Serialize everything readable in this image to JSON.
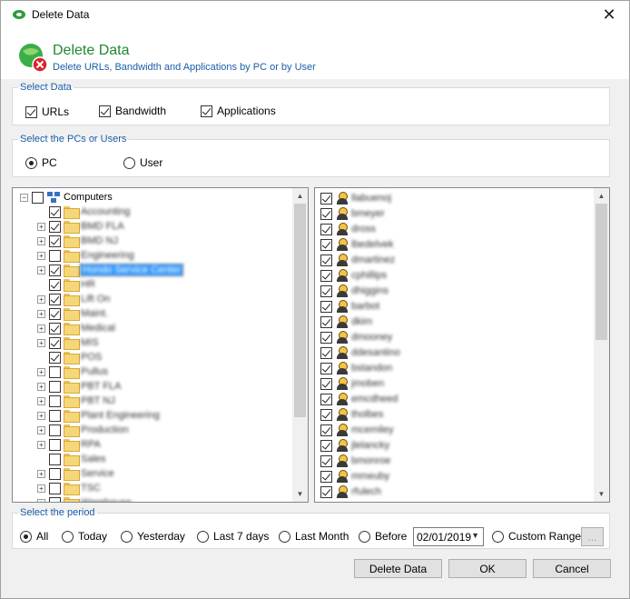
{
  "window": {
    "title": "Delete Data",
    "close_glyph": "✕"
  },
  "header": {
    "title": "Delete Data",
    "subtitle": "Delete URLs, Bandwidth and Applications by PC or by User"
  },
  "select_data": {
    "legend": "Select Data",
    "options": [
      {
        "label": "URLs",
        "checked": true
      },
      {
        "label": "Bandwidth",
        "checked": true
      },
      {
        "label": "Applications",
        "checked": true
      }
    ]
  },
  "select_pcs": {
    "legend": "Select the PCs or Users",
    "options": [
      {
        "label": "PC",
        "selected": true
      },
      {
        "label": "User",
        "selected": false
      }
    ]
  },
  "tree": {
    "root_label": "Computers",
    "items": [
      {
        "label": "Accounting",
        "checked": true,
        "expander": false
      },
      {
        "label": "BMD FLA",
        "checked": true,
        "expander": true
      },
      {
        "label": "BMD NJ",
        "checked": true,
        "expander": true
      },
      {
        "label": "Engineering",
        "checked": false,
        "expander": true
      },
      {
        "label": "Hondo Service Center",
        "checked": true,
        "expander": true,
        "selected": true
      },
      {
        "label": "HR",
        "checked": true,
        "expander": false
      },
      {
        "label": "Lift On",
        "checked": true,
        "expander": true
      },
      {
        "label": "Maint.",
        "checked": true,
        "expander": true
      },
      {
        "label": "Medical",
        "checked": true,
        "expander": true
      },
      {
        "label": "MIS",
        "checked": true,
        "expander": true
      },
      {
        "label": "POS",
        "checked": true,
        "expander": false
      },
      {
        "label": "Pullus",
        "checked": false,
        "expander": true
      },
      {
        "label": "PBT FLA",
        "checked": false,
        "expander": true
      },
      {
        "label": "PBT NJ",
        "checked": false,
        "expander": true
      },
      {
        "label": "Plant Engineering",
        "checked": false,
        "expander": true
      },
      {
        "label": "Production",
        "checked": false,
        "expander": true
      },
      {
        "label": "RPA",
        "checked": false,
        "expander": true
      },
      {
        "label": "Sales",
        "checked": false,
        "expander": false
      },
      {
        "label": "Service",
        "checked": false,
        "expander": true
      },
      {
        "label": "TSC",
        "checked": false,
        "expander": true
      },
      {
        "label": "Warehouse",
        "checked": false,
        "expander": true
      }
    ]
  },
  "users": [
    {
      "label": "llabuenoj",
      "checked": true
    },
    {
      "label": "bmeyer",
      "checked": true
    },
    {
      "label": "dross",
      "checked": true
    },
    {
      "label": "lbedelvek",
      "checked": true
    },
    {
      "label": "dmartinez",
      "checked": true
    },
    {
      "label": "cphillips",
      "checked": true
    },
    {
      "label": "dhiggins",
      "checked": true
    },
    {
      "label": "barbot",
      "checked": true
    },
    {
      "label": "dkim",
      "checked": true
    },
    {
      "label": "dmooney",
      "checked": true
    },
    {
      "label": "ddesantino",
      "checked": true
    },
    {
      "label": "bstandon",
      "checked": true
    },
    {
      "label": "jmoben",
      "checked": true
    },
    {
      "label": "emcdheed",
      "checked": true
    },
    {
      "label": "tholbes",
      "checked": true
    },
    {
      "label": "mcemiley",
      "checked": true
    },
    {
      "label": "jlelancky",
      "checked": true
    },
    {
      "label": "bmonroe",
      "checked": true
    },
    {
      "label": "mmeuby",
      "checked": true
    },
    {
      "label": "rfulech",
      "checked": true
    }
  ],
  "period": {
    "legend": "Select the period",
    "options": [
      {
        "label": "All",
        "selected": true
      },
      {
        "label": "Today",
        "selected": false
      },
      {
        "label": "Yesterday",
        "selected": false
      },
      {
        "label": "Last 7 days",
        "selected": false
      },
      {
        "label": "Last Month",
        "selected": false
      },
      {
        "label": "Before",
        "selected": false
      },
      {
        "label": "Custom Range",
        "selected": false
      }
    ],
    "before_date": "02/01/2019",
    "range_button": "..."
  },
  "buttons": {
    "delete": "Delete Data",
    "ok": "OK",
    "cancel": "Cancel"
  }
}
